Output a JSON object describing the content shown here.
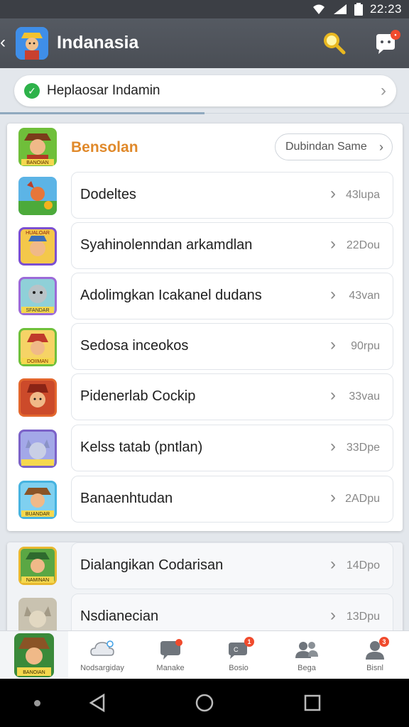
{
  "status_bar": {
    "time": "22:23"
  },
  "app_bar": {
    "title": "Indanasia"
  },
  "notice": {
    "text": "Heplaosar Indamin"
  },
  "section": {
    "title": "Bensolan",
    "see_all_label": "Dubindan Same",
    "items": [
      {
        "title": "Dodeltes",
        "meta": "43lupa"
      },
      {
        "title": "Syahinolenndan arkamdlan",
        "meta": "22Dou"
      },
      {
        "title": "Adolimgkan Icakanel dudans",
        "meta": "43van"
      },
      {
        "title": "Sedosa inceokos",
        "meta": "90rpu"
      },
      {
        "title": "Pidenerlab Cockip",
        "meta": "33vau"
      },
      {
        "title": "Kelss tatab (pntlan)",
        "meta": "33Dpe"
      },
      {
        "title": "Banaenhtudan",
        "meta": "2ADpu"
      }
    ],
    "thumb_labels": [
      "BANOIAN",
      "HUALOAR",
      "SFANDAR",
      "DOIIMAN",
      "BUANDAR"
    ]
  },
  "section2": {
    "items": [
      {
        "title": "Dialangikan Codarisan",
        "meta": "14Dpo"
      },
      {
        "title": "Nsdianecian",
        "meta": "13Dpu"
      }
    ],
    "thumb_labels": [
      "NAMINAN"
    ]
  },
  "bottom_nav": {
    "active_label": "BANOIAN",
    "items": [
      {
        "label": "Nodsargiday"
      },
      {
        "label": "Manake"
      },
      {
        "label": "Bosio"
      },
      {
        "label": "Bega"
      },
      {
        "label": "Bisnl"
      }
    ],
    "badges": [
      "1",
      "3"
    ]
  },
  "colors": {
    "accent": "#e0892a",
    "app_bar": "#4e5259",
    "badge": "#f04b2d",
    "check": "#2eb24a"
  }
}
